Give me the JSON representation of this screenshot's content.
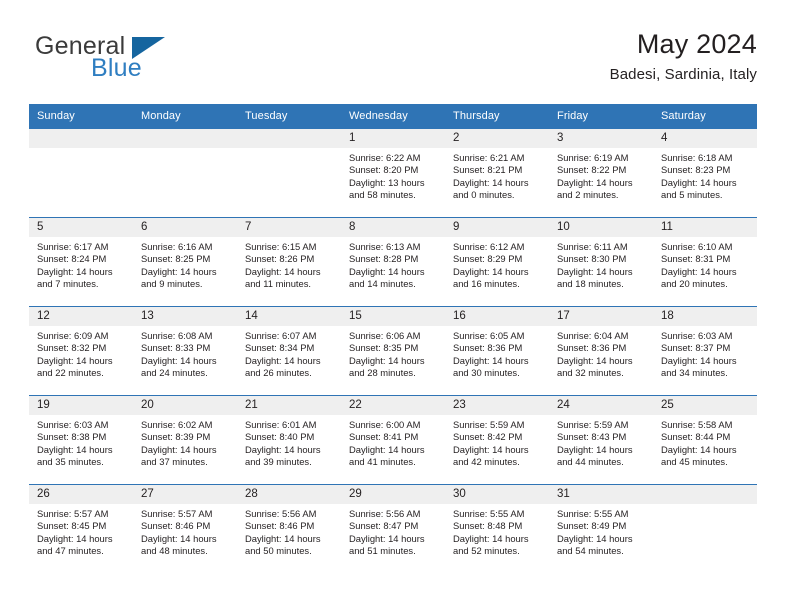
{
  "brand": {
    "name_part1": "General",
    "name_part2": "Blue",
    "triangle_icon": "triangle-icon",
    "colors": {
      "general_text": "#3b3b3b",
      "blue_text": "#2f7ec1",
      "triangle": "#15659f"
    }
  },
  "header": {
    "title": "May 2024",
    "subtitle": "Badesi, Sardinia, Italy"
  },
  "calendar": {
    "header_bg": "#2f74b5",
    "header_text_color": "#ffffff",
    "day_band_bg": "#efefef",
    "weekdays": [
      "Sunday",
      "Monday",
      "Tuesday",
      "Wednesday",
      "Thursday",
      "Friday",
      "Saturday"
    ],
    "weeks": [
      [
        {
          "day": "",
          "empty": true
        },
        {
          "day": "",
          "empty": true
        },
        {
          "day": "",
          "empty": true
        },
        {
          "day": "1",
          "sunrise": "Sunrise: 6:22 AM",
          "sunset": "Sunset: 8:20 PM",
          "daylight": "Daylight: 13 hours and 58 minutes."
        },
        {
          "day": "2",
          "sunrise": "Sunrise: 6:21 AM",
          "sunset": "Sunset: 8:21 PM",
          "daylight": "Daylight: 14 hours and 0 minutes."
        },
        {
          "day": "3",
          "sunrise": "Sunrise: 6:19 AM",
          "sunset": "Sunset: 8:22 PM",
          "daylight": "Daylight: 14 hours and 2 minutes."
        },
        {
          "day": "4",
          "sunrise": "Sunrise: 6:18 AM",
          "sunset": "Sunset: 8:23 PM",
          "daylight": "Daylight: 14 hours and 5 minutes."
        }
      ],
      [
        {
          "day": "5",
          "sunrise": "Sunrise: 6:17 AM",
          "sunset": "Sunset: 8:24 PM",
          "daylight": "Daylight: 14 hours and 7 minutes."
        },
        {
          "day": "6",
          "sunrise": "Sunrise: 6:16 AM",
          "sunset": "Sunset: 8:25 PM",
          "daylight": "Daylight: 14 hours and 9 minutes."
        },
        {
          "day": "7",
          "sunrise": "Sunrise: 6:15 AM",
          "sunset": "Sunset: 8:26 PM",
          "daylight": "Daylight: 14 hours and 11 minutes."
        },
        {
          "day": "8",
          "sunrise": "Sunrise: 6:13 AM",
          "sunset": "Sunset: 8:28 PM",
          "daylight": "Daylight: 14 hours and 14 minutes."
        },
        {
          "day": "9",
          "sunrise": "Sunrise: 6:12 AM",
          "sunset": "Sunset: 8:29 PM",
          "daylight": "Daylight: 14 hours and 16 minutes."
        },
        {
          "day": "10",
          "sunrise": "Sunrise: 6:11 AM",
          "sunset": "Sunset: 8:30 PM",
          "daylight": "Daylight: 14 hours and 18 minutes."
        },
        {
          "day": "11",
          "sunrise": "Sunrise: 6:10 AM",
          "sunset": "Sunset: 8:31 PM",
          "daylight": "Daylight: 14 hours and 20 minutes."
        }
      ],
      [
        {
          "day": "12",
          "sunrise": "Sunrise: 6:09 AM",
          "sunset": "Sunset: 8:32 PM",
          "daylight": "Daylight: 14 hours and 22 minutes."
        },
        {
          "day": "13",
          "sunrise": "Sunrise: 6:08 AM",
          "sunset": "Sunset: 8:33 PM",
          "daylight": "Daylight: 14 hours and 24 minutes."
        },
        {
          "day": "14",
          "sunrise": "Sunrise: 6:07 AM",
          "sunset": "Sunset: 8:34 PM",
          "daylight": "Daylight: 14 hours and 26 minutes."
        },
        {
          "day": "15",
          "sunrise": "Sunrise: 6:06 AM",
          "sunset": "Sunset: 8:35 PM",
          "daylight": "Daylight: 14 hours and 28 minutes."
        },
        {
          "day": "16",
          "sunrise": "Sunrise: 6:05 AM",
          "sunset": "Sunset: 8:36 PM",
          "daylight": "Daylight: 14 hours and 30 minutes."
        },
        {
          "day": "17",
          "sunrise": "Sunrise: 6:04 AM",
          "sunset": "Sunset: 8:36 PM",
          "daylight": "Daylight: 14 hours and 32 minutes."
        },
        {
          "day": "18",
          "sunrise": "Sunrise: 6:03 AM",
          "sunset": "Sunset: 8:37 PM",
          "daylight": "Daylight: 14 hours and 34 minutes."
        }
      ],
      [
        {
          "day": "19",
          "sunrise": "Sunrise: 6:03 AM",
          "sunset": "Sunset: 8:38 PM",
          "daylight": "Daylight: 14 hours and 35 minutes."
        },
        {
          "day": "20",
          "sunrise": "Sunrise: 6:02 AM",
          "sunset": "Sunset: 8:39 PM",
          "daylight": "Daylight: 14 hours and 37 minutes."
        },
        {
          "day": "21",
          "sunrise": "Sunrise: 6:01 AM",
          "sunset": "Sunset: 8:40 PM",
          "daylight": "Daylight: 14 hours and 39 minutes."
        },
        {
          "day": "22",
          "sunrise": "Sunrise: 6:00 AM",
          "sunset": "Sunset: 8:41 PM",
          "daylight": "Daylight: 14 hours and 41 minutes."
        },
        {
          "day": "23",
          "sunrise": "Sunrise: 5:59 AM",
          "sunset": "Sunset: 8:42 PM",
          "daylight": "Daylight: 14 hours and 42 minutes."
        },
        {
          "day": "24",
          "sunrise": "Sunrise: 5:59 AM",
          "sunset": "Sunset: 8:43 PM",
          "daylight": "Daylight: 14 hours and 44 minutes."
        },
        {
          "day": "25",
          "sunrise": "Sunrise: 5:58 AM",
          "sunset": "Sunset: 8:44 PM",
          "daylight": "Daylight: 14 hours and 45 minutes."
        }
      ],
      [
        {
          "day": "26",
          "sunrise": "Sunrise: 5:57 AM",
          "sunset": "Sunset: 8:45 PM",
          "daylight": "Daylight: 14 hours and 47 minutes."
        },
        {
          "day": "27",
          "sunrise": "Sunrise: 5:57 AM",
          "sunset": "Sunset: 8:46 PM",
          "daylight": "Daylight: 14 hours and 48 minutes."
        },
        {
          "day": "28",
          "sunrise": "Sunrise: 5:56 AM",
          "sunset": "Sunset: 8:46 PM",
          "daylight": "Daylight: 14 hours and 50 minutes."
        },
        {
          "day": "29",
          "sunrise": "Sunrise: 5:56 AM",
          "sunset": "Sunset: 8:47 PM",
          "daylight": "Daylight: 14 hours and 51 minutes."
        },
        {
          "day": "30",
          "sunrise": "Sunrise: 5:55 AM",
          "sunset": "Sunset: 8:48 PM",
          "daylight": "Daylight: 14 hours and 52 minutes."
        },
        {
          "day": "31",
          "sunrise": "Sunrise: 5:55 AM",
          "sunset": "Sunset: 8:49 PM",
          "daylight": "Daylight: 14 hours and 54 minutes."
        },
        {
          "day": "",
          "empty": true
        }
      ]
    ]
  }
}
